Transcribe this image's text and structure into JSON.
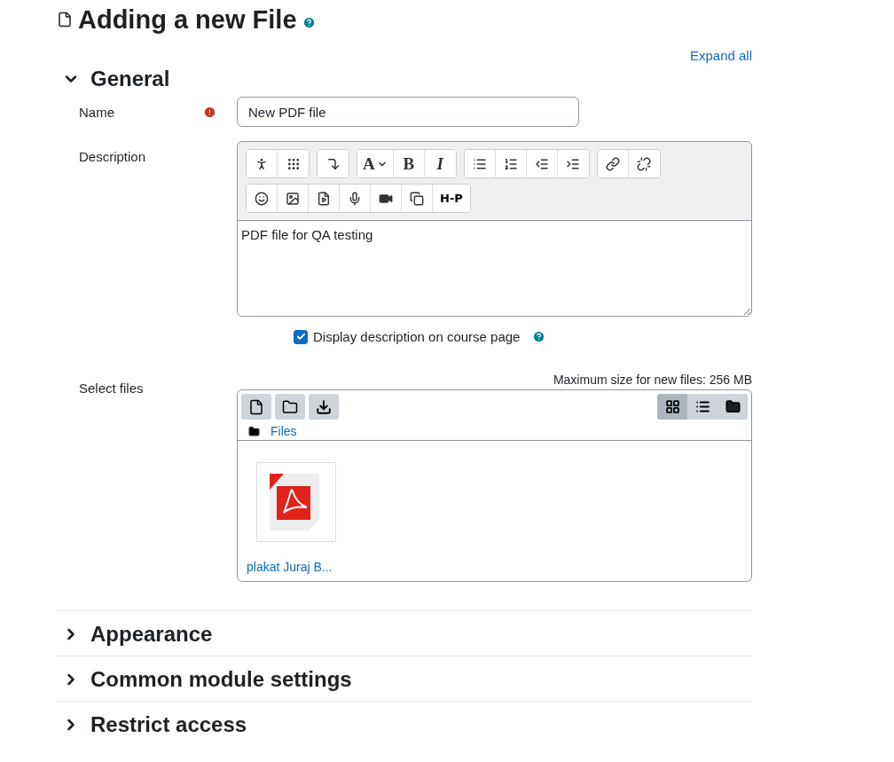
{
  "page_title": "Adding a new File",
  "expand_all": "Expand all",
  "sections": [
    {
      "title": "General",
      "expanded": true
    },
    {
      "title": "Appearance",
      "expanded": false
    },
    {
      "title": "Common module settings",
      "expanded": false
    },
    {
      "title": "Restrict access",
      "expanded": false
    }
  ],
  "name_field": {
    "label": "Name",
    "required": true,
    "value": "New PDF file"
  },
  "description": {
    "label": "Description",
    "glyphs": [
      "A",
      "B",
      "I",
      "H-P"
    ],
    "value": "PDF file for QA testing"
  },
  "display_checkbox": {
    "label": "Display description on course page",
    "checked": true
  },
  "select_files": {
    "label": "Select files",
    "max_size": "Maximum size for new files: 256 MB",
    "view_modes": [
      {
        "selected": true
      },
      {
        "selected": false
      },
      {
        "selected": false
      }
    ],
    "path": "Files",
    "files": [
      {
        "name": "plakat Juraj B..."
      }
    ]
  }
}
